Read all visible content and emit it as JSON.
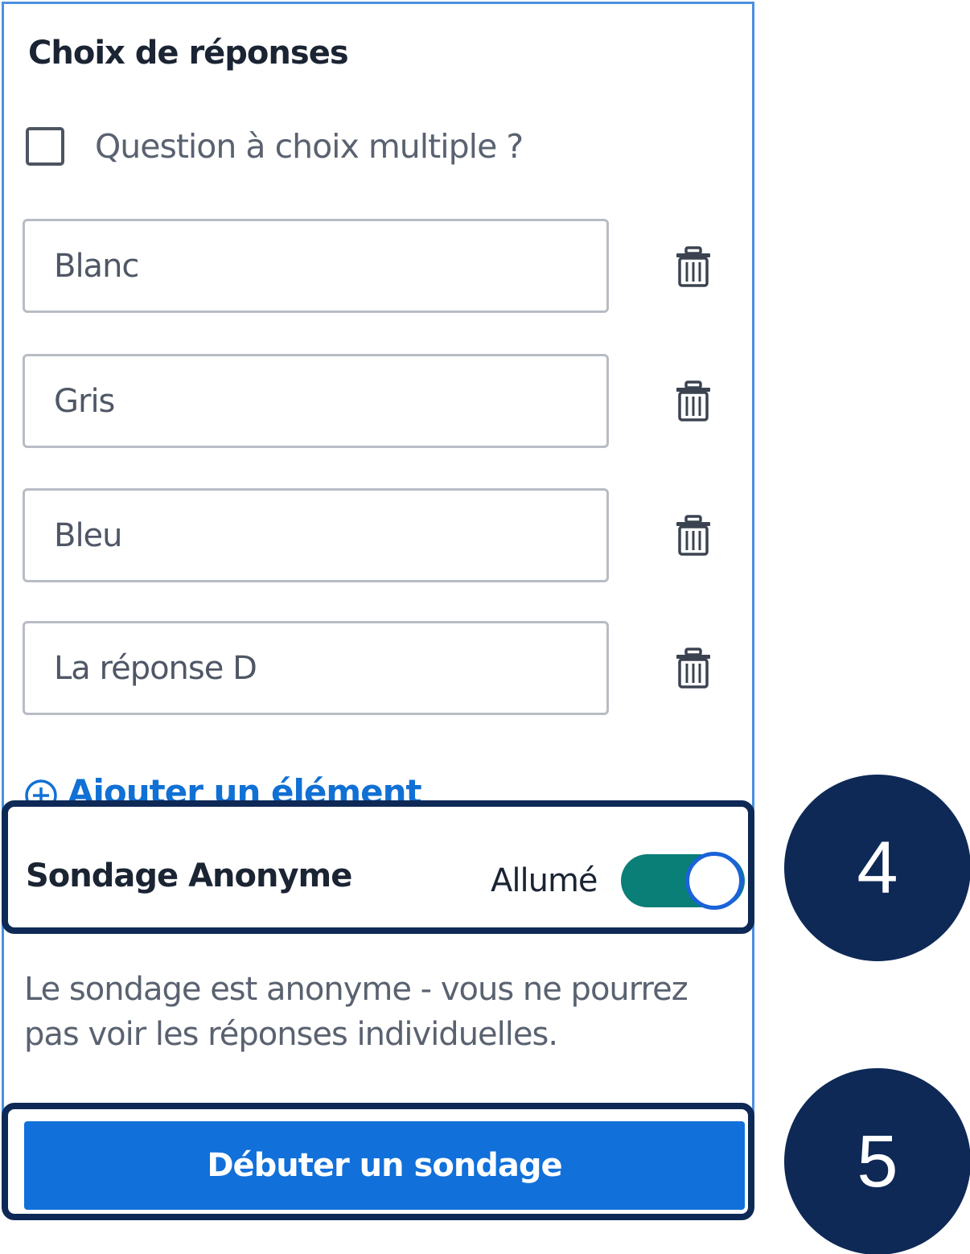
{
  "section": {
    "heading": "Choix de réponses",
    "multiple_choice_label": "Question à choix multiple ?",
    "multiple_choice_checked": false
  },
  "answers": [
    {
      "value": "Blanc"
    },
    {
      "value": "Gris"
    },
    {
      "value": "Bleu"
    },
    {
      "value": "La réponse D"
    }
  ],
  "add_item_label": "Ajouter un élément",
  "anonymous": {
    "title": "Sondage Anonyme",
    "status": "Allumé",
    "enabled": true,
    "note": "Le sondage est anonyme - vous ne pourrez pas voir les réponses individuelles."
  },
  "start_button_label": "Débuter un sondage",
  "callouts": {
    "step_4": "4",
    "step_5": "5"
  },
  "colors": {
    "accent": "#1170d9",
    "toggle_on": "#0a7f78",
    "callout": "#0e2956"
  }
}
